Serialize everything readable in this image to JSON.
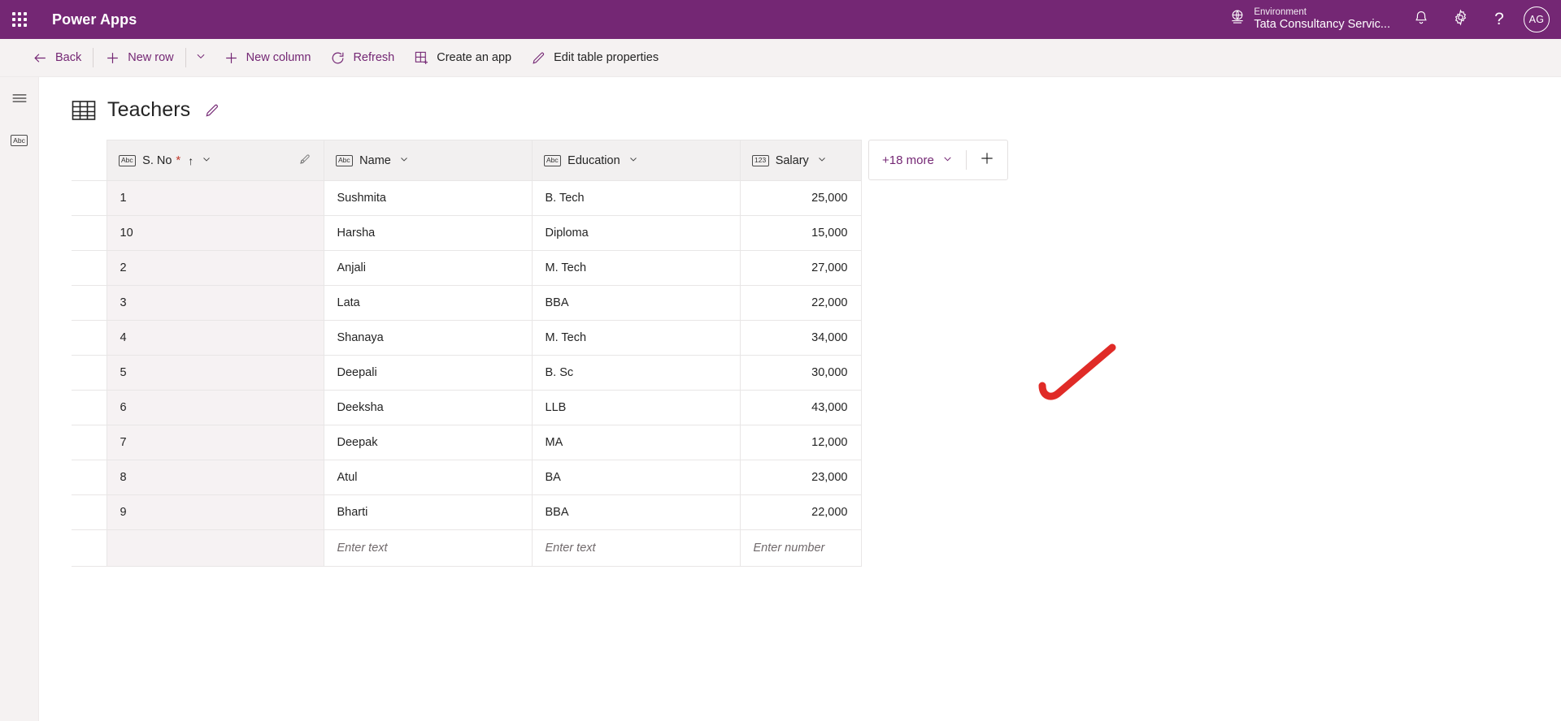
{
  "topbar": {
    "waffle_icon": "app-launcher-icon",
    "brand": "Power Apps",
    "environment_label": "Environment",
    "environment_name": "Tata Consultancy Servic...",
    "globe_icon": "environment-globe-icon",
    "bell_icon": "notifications-icon",
    "gear_icon": "settings-icon",
    "help_icon": "help-icon",
    "help_glyph": "?",
    "avatar_initials": "AG",
    "bg_color": "#742774"
  },
  "commandbar": {
    "back": "Back",
    "new_row": "New row",
    "new_row_caret": "⌄",
    "new_column": "New column",
    "refresh": "Refresh",
    "create_app": "Create an app",
    "edit_table_properties": "Edit table properties",
    "accent_color": "#742774"
  },
  "rail": {
    "menu_icon": "hamburger-menu-icon",
    "text_column_icon": "abc-text-icon",
    "abc_glyph": "Abc"
  },
  "page": {
    "table_icon": "table-grid-icon",
    "title": "Teachers",
    "edit_title_icon": "pencil-edit-icon"
  },
  "grid": {
    "columns": [
      {
        "label": "S. No",
        "type_glyph": "Abc",
        "type_icon": "abc-text-icon",
        "required": true,
        "required_mark": "*",
        "sorted": true,
        "sort_glyph": "↑",
        "menu_glyph": "⌄",
        "key_icon": "primary-key-icon",
        "align": "left"
      },
      {
        "label": "Name",
        "type_glyph": "Abc",
        "type_icon": "abc-text-icon",
        "required": false,
        "required_mark": "",
        "sorted": false,
        "sort_glyph": "",
        "menu_glyph": "⌄",
        "align": "left"
      },
      {
        "label": "Education",
        "type_glyph": "Abc",
        "type_icon": "abc-text-icon",
        "required": false,
        "required_mark": "",
        "sorted": false,
        "sort_glyph": "",
        "menu_glyph": "⌄",
        "align": "left"
      },
      {
        "label": "Salary",
        "type_glyph": "123",
        "type_icon": "number-123-icon",
        "required": false,
        "required_mark": "",
        "sorted": false,
        "sort_glyph": "",
        "menu_glyph": "⌄",
        "align": "right"
      }
    ],
    "more_columns_label": "+18 more",
    "more_columns_chevron": "⌄",
    "add_column_glyph": "+",
    "rows": [
      {
        "sno": "1",
        "name": "Sushmita",
        "education": "B. Tech",
        "salary": "25,000"
      },
      {
        "sno": "10",
        "name": "Harsha",
        "education": "Diploma",
        "salary": "15,000"
      },
      {
        "sno": "2",
        "name": "Anjali",
        "education": "M. Tech",
        "salary": "27,000"
      },
      {
        "sno": "3",
        "name": "Lata",
        "education": "BBA",
        "salary": "22,000"
      },
      {
        "sno": "4",
        "name": "Shanaya",
        "education": "M. Tech",
        "salary": "34,000"
      },
      {
        "sno": "5",
        "name": "Deepali",
        "education": "B. Sc",
        "salary": "30,000"
      },
      {
        "sno": "6",
        "name": "Deeksha",
        "education": "LLB",
        "salary": "43,000"
      },
      {
        "sno": "7",
        "name": "Deepak",
        "education": "MA",
        "salary": "12,000"
      },
      {
        "sno": "8",
        "name": "Atul",
        "education": "BA",
        "salary": "23,000"
      },
      {
        "sno": "9",
        "name": "Bharti",
        "education": "BBA",
        "salary": "22,000"
      }
    ],
    "new_row": {
      "sno_placeholder": "",
      "name_placeholder": "Enter text",
      "education_placeholder": "Enter text",
      "salary_placeholder": "Enter number"
    }
  },
  "annotation": {
    "shape": "red-checkmark-annotation",
    "color": "#e02b27"
  }
}
